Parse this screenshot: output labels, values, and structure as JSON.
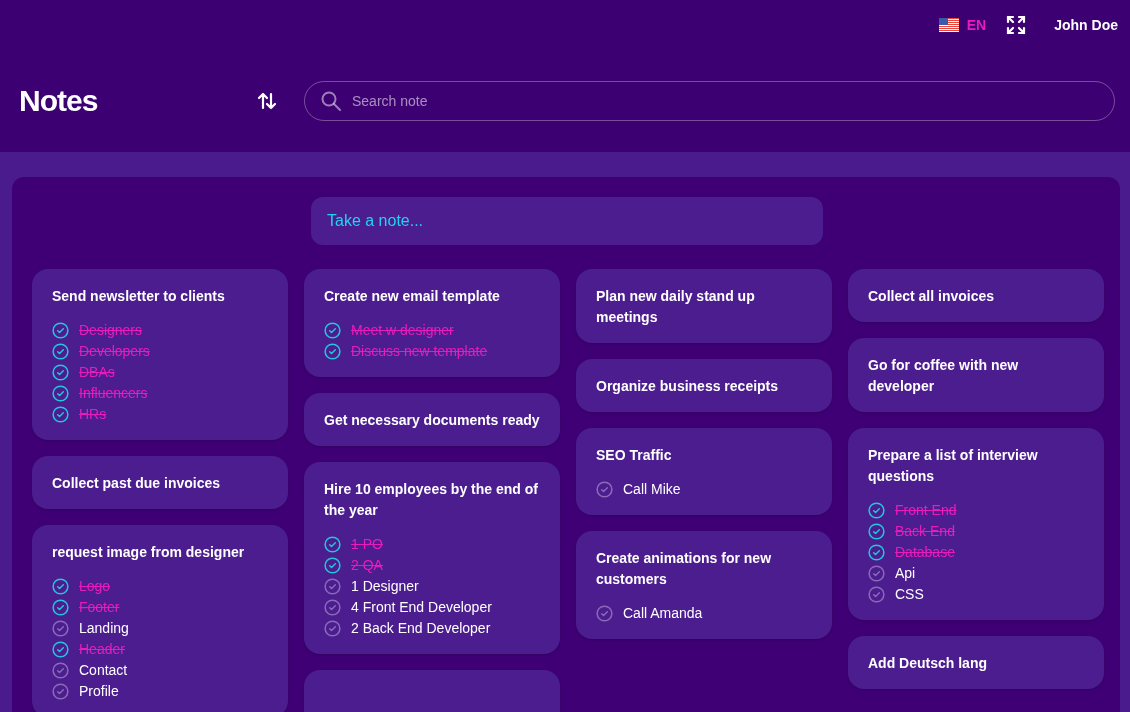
{
  "top_bar": {
    "language": "EN",
    "user": "John Doe"
  },
  "header": {
    "title": "Notes",
    "search": {
      "placeholder": "Search note"
    }
  },
  "composer": {
    "placeholder": "Take a note..."
  },
  "columns": [
    {
      "notes": [
        {
          "kind": "note",
          "title": "Send newsletter to clients",
          "items": [
            {
              "text": "Designers",
              "checked": true
            },
            {
              "text": "Developers",
              "checked": true
            },
            {
              "text": "DBAs",
              "checked": true
            },
            {
              "text": "Influencers",
              "checked": true
            },
            {
              "text": "HRs",
              "checked": true
            }
          ]
        },
        {
          "kind": "note",
          "title": "Collect past due invoices"
        },
        {
          "kind": "note",
          "title": "request image from designer",
          "items": [
            {
              "text": "Logo",
              "checked": true
            },
            {
              "text": "Footer",
              "checked": true
            },
            {
              "text": "Landing",
              "checked": false
            },
            {
              "text": "Header",
              "checked": true
            },
            {
              "text": "Contact",
              "checked": false
            },
            {
              "text": "Profile",
              "checked": false
            }
          ]
        }
      ]
    },
    {
      "notes": [
        {
          "kind": "note",
          "title": "Create new email template",
          "items": [
            {
              "text": "Meet w designer",
              "checked": true
            },
            {
              "text": "Discuss new template",
              "checked": true
            }
          ]
        },
        {
          "kind": "note",
          "title": "Get necessary documents ready"
        },
        {
          "kind": "note",
          "title": "Hire 10 employees by the end of the year",
          "items": [
            {
              "text": "1 PO",
              "checked": true
            },
            {
              "text": "2 QA",
              "checked": true
            },
            {
              "text": "1 Designer",
              "checked": false
            },
            {
              "text": "4 Front End Developer",
              "checked": false
            },
            {
              "text": "2 Back End Developer",
              "checked": false
            }
          ]
        },
        {
          "kind": "cut_off"
        }
      ]
    },
    {
      "notes": [
        {
          "kind": "note",
          "title": "Plan new daily stand up meetings"
        },
        {
          "kind": "note",
          "title": "Organize business receipts"
        },
        {
          "kind": "note",
          "title": "SEO Traffic",
          "items": [
            {
              "text": "Call Mike",
              "checked": false
            }
          ]
        },
        {
          "kind": "note",
          "title": "Create animations for new customers",
          "items": [
            {
              "text": "Call Amanda",
              "checked": false
            }
          ]
        }
      ]
    },
    {
      "notes": [
        {
          "kind": "note",
          "title": "Collect all invoices"
        },
        {
          "kind": "note",
          "title": "Go for coffee with new developer"
        },
        {
          "kind": "note",
          "title": "Prepare a list of interview questions",
          "items": [
            {
              "text": "Front  End",
              "checked": true
            },
            {
              "text": "Back  End",
              "checked": true
            },
            {
              "text": "Database",
              "checked": true
            },
            {
              "text": "Api",
              "checked": false
            },
            {
              "text": "CSS",
              "checked": false
            }
          ]
        },
        {
          "kind": "note",
          "title": "Add Deutsch lang"
        }
      ]
    }
  ]
}
